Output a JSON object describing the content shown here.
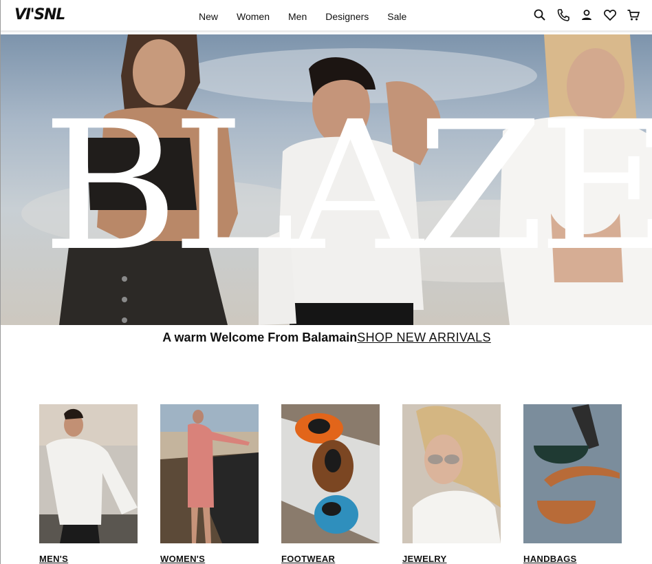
{
  "header": {
    "logo": "VI'SNL",
    "nav": [
      "New",
      "Women",
      "Men",
      "Designers",
      "Sale"
    ],
    "icons": [
      "search-icon",
      "phone-icon",
      "account-icon",
      "wishlist-icon",
      "cart-icon"
    ]
  },
  "hero": {
    "headline": "BLAZE"
  },
  "welcome": {
    "text": "A warm Welcome From Balamain",
    "link": "SHOP NEW ARRIVALS"
  },
  "categories": [
    {
      "label": "MEN'S"
    },
    {
      "label": "WOMEN'S"
    },
    {
      "label": "FOOTWEAR"
    },
    {
      "label": "JEWELRY"
    },
    {
      "label": "HANDBAGS"
    }
  ]
}
